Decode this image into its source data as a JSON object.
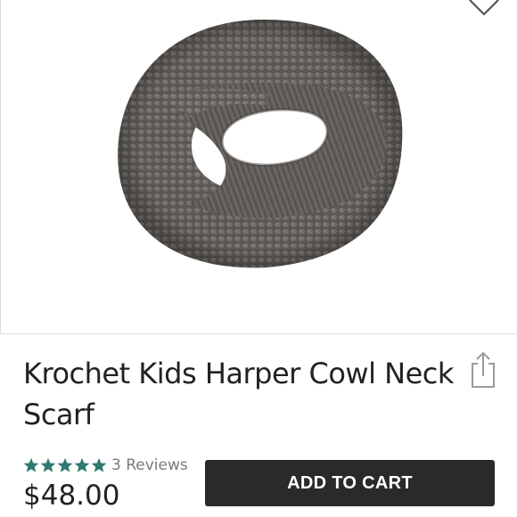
{
  "product": {
    "title": "Krochet Kids Harper Cowl Neck Scarf",
    "image_icon": "knit-cowl-scarf-image",
    "rating_stars": 5,
    "reviews_label": "3 Reviews",
    "price": "$48.00"
  },
  "actions": {
    "add_to_cart_label": "ADD TO CART",
    "favorite_icon": "heart-icon",
    "share_icon": "share-icon"
  },
  "colors": {
    "star": "#2e7a72",
    "button_bg": "#2a2a2a",
    "scarf": "#5d5955"
  }
}
